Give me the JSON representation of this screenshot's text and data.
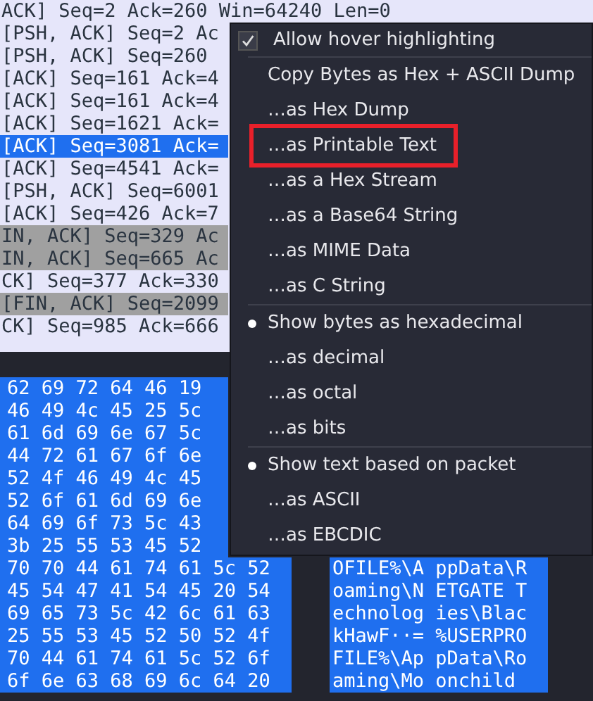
{
  "packet_list": {
    "rows": [
      {
        "info": "ACK] Seq=2 Ack=260 Win=64240 Len=0",
        "color": "#e6e6fa",
        "selected": false
      },
      {
        "info": "[PSH, ACK] Seq=2 Ac",
        "color": "#e6e6fa",
        "selected": false
      },
      {
        "info": "[PSH, ACK] Seq=260",
        "color": "#e6e6fa",
        "selected": false
      },
      {
        "info": "[ACK] Seq=161 Ack=4",
        "color": "#e6e6fa",
        "selected": false
      },
      {
        "info": "[ACK] Seq=161 Ack=4",
        "color": "#e6e6fa",
        "selected": false
      },
      {
        "info": "[ACK] Seq=1621 Ack=",
        "color": "#e6e6fa",
        "selected": false
      },
      {
        "info": "[ACK] Seq=3081 Ack=",
        "selected": true
      },
      {
        "info": "[ACK] Seq=4541 Ack=",
        "color": "#e6e6fa",
        "selected": false
      },
      {
        "info": "[PSH, ACK] Seq=6001",
        "color": "#e6e6fa",
        "selected": false
      },
      {
        "info": "[ACK] Seq=426 Ack=7",
        "color": "#e6e6fa",
        "selected": false
      },
      {
        "info": "IN, ACK] Seq=329 Ac",
        "color": "#a0a0a0",
        "selected": false
      },
      {
        "info": "IN, ACK] Seq=665 Ac",
        "color": "#a0a0a0",
        "selected": false
      },
      {
        "info": "CK] Seq=377 Ack=330",
        "color": "#e6e6fa",
        "selected": false
      },
      {
        "info": "[FIN, ACK] Seq=2099",
        "color": "#a0a0a0",
        "selected": false
      },
      {
        "info": "CK] Seq=985 Ack=666",
        "color": "#e6e6fa",
        "selected": false
      }
    ]
  },
  "bytes_pane": {
    "rows": [
      {
        "hex": "62 69 72 64 46 19"
      },
      {
        "hex": "46 49 4c 45 25 5c"
      },
      {
        "hex": "61 6d 69 6e 67 5c"
      },
      {
        "hex": "44 72 61 67 6f 6e"
      },
      {
        "hex": "52 4f 46 49 4c 45"
      },
      {
        "hex": "52 6f 61 6d 69 6e"
      },
      {
        "hex": "64 69 6f 73 5c 43"
      },
      {
        "hex": "3b 25 55 53 45 52"
      },
      {
        "hex": "70 70 44 61 74 61 5c 52",
        "ascii": "OFILE%\\A ppData\\R"
      },
      {
        "hex": "45 54 47 41 54 45 20 54",
        "ascii": "oaming\\N ETGATE T"
      },
      {
        "hex": "69 65 73 5c 42 6c 61 63",
        "ascii": "echnolog ies\\Blac"
      },
      {
        "hex": "25 55 53 45 52 50 52 4f",
        "ascii": "kHawF··= %USERPRO"
      },
      {
        "hex": "70 44 61 74 61 5c 52 6f",
        "ascii": "FILE%\\Ap pData\\Ro"
      },
      {
        "hex": "6f 6e 63 68 69 6c 64 20",
        "ascii": "aming\\Mo onchild"
      }
    ]
  },
  "context_menu": {
    "items": [
      {
        "kind": "check",
        "label": "Allow hover highlighting",
        "checked": true
      },
      {
        "kind": "separator"
      },
      {
        "kind": "item",
        "label": "Copy Bytes as Hex + ASCII Dump",
        "highlighted": false
      },
      {
        "kind": "item",
        "label": "…as Hex Dump",
        "highlighted": false
      },
      {
        "kind": "item",
        "label": "…as Printable Text",
        "highlighted": true
      },
      {
        "kind": "item",
        "label": "…as a Hex Stream",
        "highlighted": false
      },
      {
        "kind": "item",
        "label": "…as a Base64 String",
        "highlighted": false
      },
      {
        "kind": "item",
        "label": "…as MIME Data",
        "highlighted": false
      },
      {
        "kind": "item",
        "label": "…as C String",
        "highlighted": false
      },
      {
        "kind": "separator"
      },
      {
        "kind": "radio",
        "label": "Show bytes as hexadecimal",
        "selected": true
      },
      {
        "kind": "radio",
        "label": "…as decimal",
        "selected": false
      },
      {
        "kind": "radio",
        "label": "…as octal",
        "selected": false
      },
      {
        "kind": "radio",
        "label": "…as bits",
        "selected": false
      },
      {
        "kind": "separator"
      },
      {
        "kind": "radio",
        "label": "Show text based on packet",
        "selected": true
      },
      {
        "kind": "radio",
        "label": "…as ASCII",
        "selected": false
      },
      {
        "kind": "radio",
        "label": "…as EBCDIC",
        "selected": false
      }
    ]
  }
}
